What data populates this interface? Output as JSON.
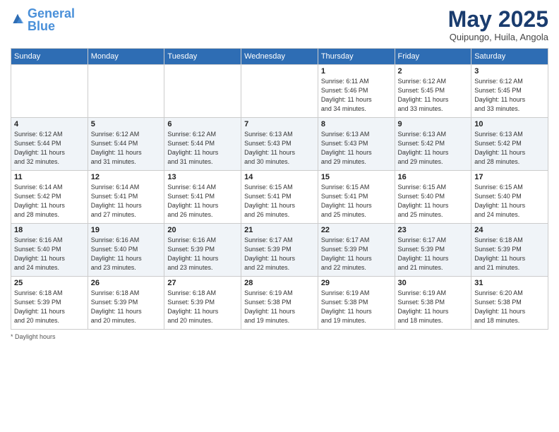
{
  "header": {
    "logo_general": "General",
    "logo_blue": "Blue",
    "month_title": "May 2025",
    "location": "Quipungo, Huila, Angola"
  },
  "days_of_week": [
    "Sunday",
    "Monday",
    "Tuesday",
    "Wednesday",
    "Thursday",
    "Friday",
    "Saturday"
  ],
  "footer": {
    "label": "Daylight hours"
  },
  "weeks": [
    [
      {
        "day": "",
        "info": ""
      },
      {
        "day": "",
        "info": ""
      },
      {
        "day": "",
        "info": ""
      },
      {
        "day": "",
        "info": ""
      },
      {
        "day": "1",
        "info": "Sunrise: 6:11 AM\nSunset: 5:46 PM\nDaylight: 11 hours\nand 34 minutes."
      },
      {
        "day": "2",
        "info": "Sunrise: 6:12 AM\nSunset: 5:45 PM\nDaylight: 11 hours\nand 33 minutes."
      },
      {
        "day": "3",
        "info": "Sunrise: 6:12 AM\nSunset: 5:45 PM\nDaylight: 11 hours\nand 33 minutes."
      }
    ],
    [
      {
        "day": "4",
        "info": "Sunrise: 6:12 AM\nSunset: 5:44 PM\nDaylight: 11 hours\nand 32 minutes."
      },
      {
        "day": "5",
        "info": "Sunrise: 6:12 AM\nSunset: 5:44 PM\nDaylight: 11 hours\nand 31 minutes."
      },
      {
        "day": "6",
        "info": "Sunrise: 6:12 AM\nSunset: 5:44 PM\nDaylight: 11 hours\nand 31 minutes."
      },
      {
        "day": "7",
        "info": "Sunrise: 6:13 AM\nSunset: 5:43 PM\nDaylight: 11 hours\nand 30 minutes."
      },
      {
        "day": "8",
        "info": "Sunrise: 6:13 AM\nSunset: 5:43 PM\nDaylight: 11 hours\nand 29 minutes."
      },
      {
        "day": "9",
        "info": "Sunrise: 6:13 AM\nSunset: 5:42 PM\nDaylight: 11 hours\nand 29 minutes."
      },
      {
        "day": "10",
        "info": "Sunrise: 6:13 AM\nSunset: 5:42 PM\nDaylight: 11 hours\nand 28 minutes."
      }
    ],
    [
      {
        "day": "11",
        "info": "Sunrise: 6:14 AM\nSunset: 5:42 PM\nDaylight: 11 hours\nand 28 minutes."
      },
      {
        "day": "12",
        "info": "Sunrise: 6:14 AM\nSunset: 5:41 PM\nDaylight: 11 hours\nand 27 minutes."
      },
      {
        "day": "13",
        "info": "Sunrise: 6:14 AM\nSunset: 5:41 PM\nDaylight: 11 hours\nand 26 minutes."
      },
      {
        "day": "14",
        "info": "Sunrise: 6:15 AM\nSunset: 5:41 PM\nDaylight: 11 hours\nand 26 minutes."
      },
      {
        "day": "15",
        "info": "Sunrise: 6:15 AM\nSunset: 5:41 PM\nDaylight: 11 hours\nand 25 minutes."
      },
      {
        "day": "16",
        "info": "Sunrise: 6:15 AM\nSunset: 5:40 PM\nDaylight: 11 hours\nand 25 minutes."
      },
      {
        "day": "17",
        "info": "Sunrise: 6:15 AM\nSunset: 5:40 PM\nDaylight: 11 hours\nand 24 minutes."
      }
    ],
    [
      {
        "day": "18",
        "info": "Sunrise: 6:16 AM\nSunset: 5:40 PM\nDaylight: 11 hours\nand 24 minutes."
      },
      {
        "day": "19",
        "info": "Sunrise: 6:16 AM\nSunset: 5:40 PM\nDaylight: 11 hours\nand 23 minutes."
      },
      {
        "day": "20",
        "info": "Sunrise: 6:16 AM\nSunset: 5:39 PM\nDaylight: 11 hours\nand 23 minutes."
      },
      {
        "day": "21",
        "info": "Sunrise: 6:17 AM\nSunset: 5:39 PM\nDaylight: 11 hours\nand 22 minutes."
      },
      {
        "day": "22",
        "info": "Sunrise: 6:17 AM\nSunset: 5:39 PM\nDaylight: 11 hours\nand 22 minutes."
      },
      {
        "day": "23",
        "info": "Sunrise: 6:17 AM\nSunset: 5:39 PM\nDaylight: 11 hours\nand 21 minutes."
      },
      {
        "day": "24",
        "info": "Sunrise: 6:18 AM\nSunset: 5:39 PM\nDaylight: 11 hours\nand 21 minutes."
      }
    ],
    [
      {
        "day": "25",
        "info": "Sunrise: 6:18 AM\nSunset: 5:39 PM\nDaylight: 11 hours\nand 20 minutes."
      },
      {
        "day": "26",
        "info": "Sunrise: 6:18 AM\nSunset: 5:39 PM\nDaylight: 11 hours\nand 20 minutes."
      },
      {
        "day": "27",
        "info": "Sunrise: 6:18 AM\nSunset: 5:39 PM\nDaylight: 11 hours\nand 20 minutes."
      },
      {
        "day": "28",
        "info": "Sunrise: 6:19 AM\nSunset: 5:38 PM\nDaylight: 11 hours\nand 19 minutes."
      },
      {
        "day": "29",
        "info": "Sunrise: 6:19 AM\nSunset: 5:38 PM\nDaylight: 11 hours\nand 19 minutes."
      },
      {
        "day": "30",
        "info": "Sunrise: 6:19 AM\nSunset: 5:38 PM\nDaylight: 11 hours\nand 18 minutes."
      },
      {
        "day": "31",
        "info": "Sunrise: 6:20 AM\nSunset: 5:38 PM\nDaylight: 11 hours\nand 18 minutes."
      }
    ]
  ]
}
